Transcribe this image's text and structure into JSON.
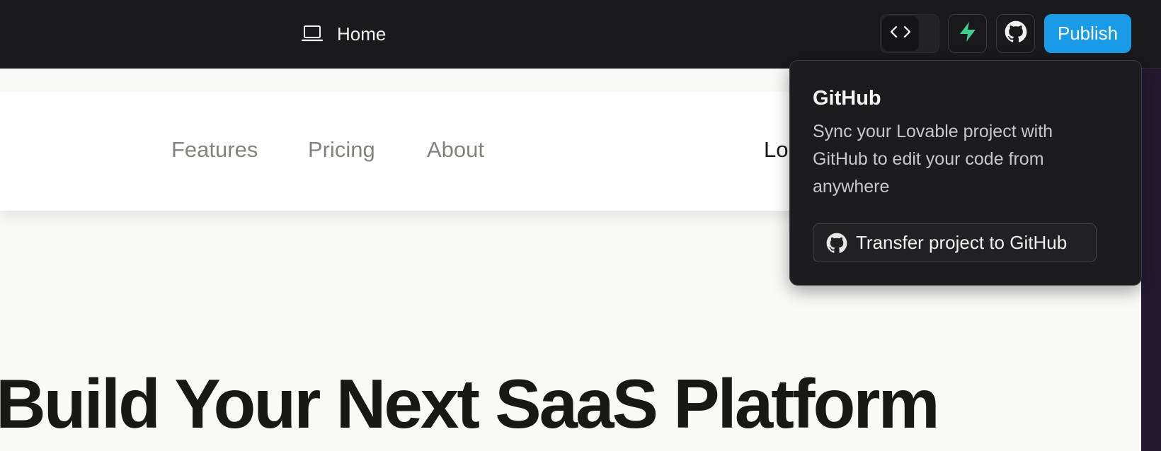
{
  "topbar": {
    "route_label": "Home",
    "route_icon": "laptop-icon",
    "code_toggle_icon": "code-brackets-icon",
    "supabase_icon": "supabase-icon",
    "github_icon": "github-icon",
    "publish_label": "Publish",
    "publish_color": "#1a9be8"
  },
  "site": {
    "nav": {
      "links": [
        "Features",
        "Pricing",
        "About"
      ],
      "login_partial": "Lo"
    },
    "hero_title": "Build Your Next SaaS Platform"
  },
  "popover": {
    "title": "GitHub",
    "description": "Sync your Lovable project with GitHub to edit your code from anywhere",
    "transfer_button_label": "Transfer project to GitHub"
  },
  "colors": {
    "topbar_bg": "#1a1a1c",
    "popover_bg": "#1c1c1e",
    "supabase_green": "#3ecf8e",
    "preview_bg": "#f9f9f7"
  }
}
